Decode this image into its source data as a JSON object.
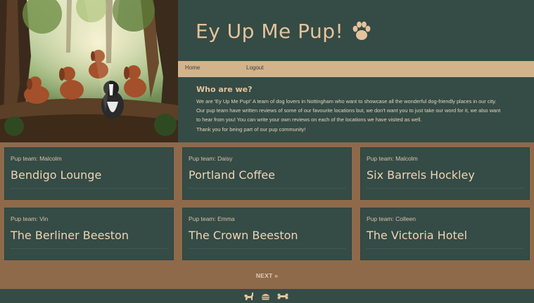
{
  "site": {
    "title": "Ey Up Me Pup!",
    "title_icon": "paw-icon"
  },
  "nav": {
    "home": "Home",
    "logout": "Logout"
  },
  "about": {
    "heading": "Who are we?",
    "lines": [
      "We are 'Ey Up Me Pup!' A team of dog lovers in Nottingham who want to showcase all the wonderful dog-friendly places in our city.",
      "Our pup team have written reviews of some of our favourite locations but, we don't want you to just take our word for it, we also want",
      "to hear from you! You can write your own reviews on each of the locations we have visited as well.",
      "Thank you for being part of our pup community!"
    ]
  },
  "cards": [
    {
      "team": "Pup team: Malcolm",
      "name": "Bendigo Lounge"
    },
    {
      "team": "Pup team: Daisy",
      "name": "Portland Coffee"
    },
    {
      "team": "Pup team: Malcolm",
      "name": "Six Barrels Hockley"
    },
    {
      "team": "Pup team: Vin",
      "name": "The Berliner Beeston"
    },
    {
      "team": "Pup team: Emma",
      "name": "The Crown Beeston"
    },
    {
      "team": "Pup team: Colleen",
      "name": "The Victoria Hotel"
    }
  ],
  "pagination": {
    "next": "NEXT »"
  },
  "footer": {
    "icons": [
      "dog-icon",
      "burger-icon",
      "bone-icon"
    ]
  },
  "colors": {
    "dark_green": "#354b45",
    "tan": "#d3b38c",
    "brown": "#8e6a4b",
    "accent_text": "#e4c39c"
  }
}
